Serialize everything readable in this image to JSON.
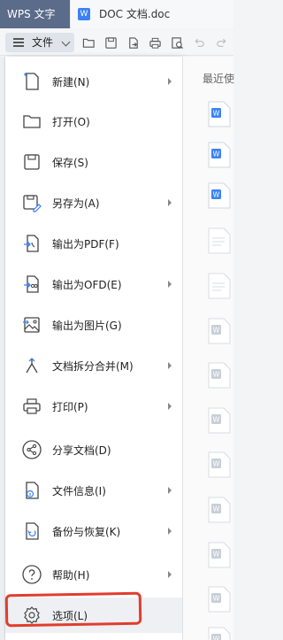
{
  "tabs": {
    "app_label": "WPS 文字",
    "doc_label": "DOC 文档.doc",
    "doc_icon_letter": "W"
  },
  "toolbar": {
    "file_label": "文件",
    "icons": [
      "folder-open-icon",
      "save-icon",
      "export-icon",
      "print-icon",
      "print-preview-icon",
      "undo-icon",
      "redo-icon"
    ]
  },
  "menu": {
    "items": [
      {
        "label": "新建(N)",
        "icon": "new-doc-icon",
        "submenu": true
      },
      {
        "label": "打开(O)",
        "icon": "folder-open-icon",
        "submenu": false
      },
      {
        "label": "保存(S)",
        "icon": "save-icon",
        "submenu": false
      },
      {
        "label": "另存为(A)",
        "icon": "save-as-icon",
        "submenu": true
      },
      {
        "label": "输出为PDF(F)",
        "icon": "pdf-export-icon",
        "submenu": false
      },
      {
        "label": "输出为OFD(E)",
        "icon": "ofd-export-icon",
        "submenu": true
      },
      {
        "label": "输出为图片(G)",
        "icon": "image-export-icon",
        "submenu": false
      },
      {
        "label": "文档拆分合并(M)",
        "icon": "split-merge-icon",
        "submenu": true
      },
      {
        "label": "打印(P)",
        "icon": "print-icon",
        "submenu": true
      },
      {
        "label": "分享文档(D)",
        "icon": "share-icon",
        "submenu": false
      },
      {
        "label": "文件信息(I)",
        "icon": "file-info-icon",
        "submenu": true
      },
      {
        "label": "备份与恢复(K)",
        "icon": "backup-restore-icon",
        "submenu": true
      },
      {
        "label": "帮助(H)",
        "icon": "help-icon",
        "submenu": true
      },
      {
        "label": "选项(L)",
        "icon": "gear-icon",
        "submenu": false
      }
    ]
  },
  "recent": {
    "title": "最近使"
  },
  "colors": {
    "app_tab": "#5b6b8a",
    "accent_blue": "#3b82f6",
    "annotation_red": "#e23c2f"
  }
}
